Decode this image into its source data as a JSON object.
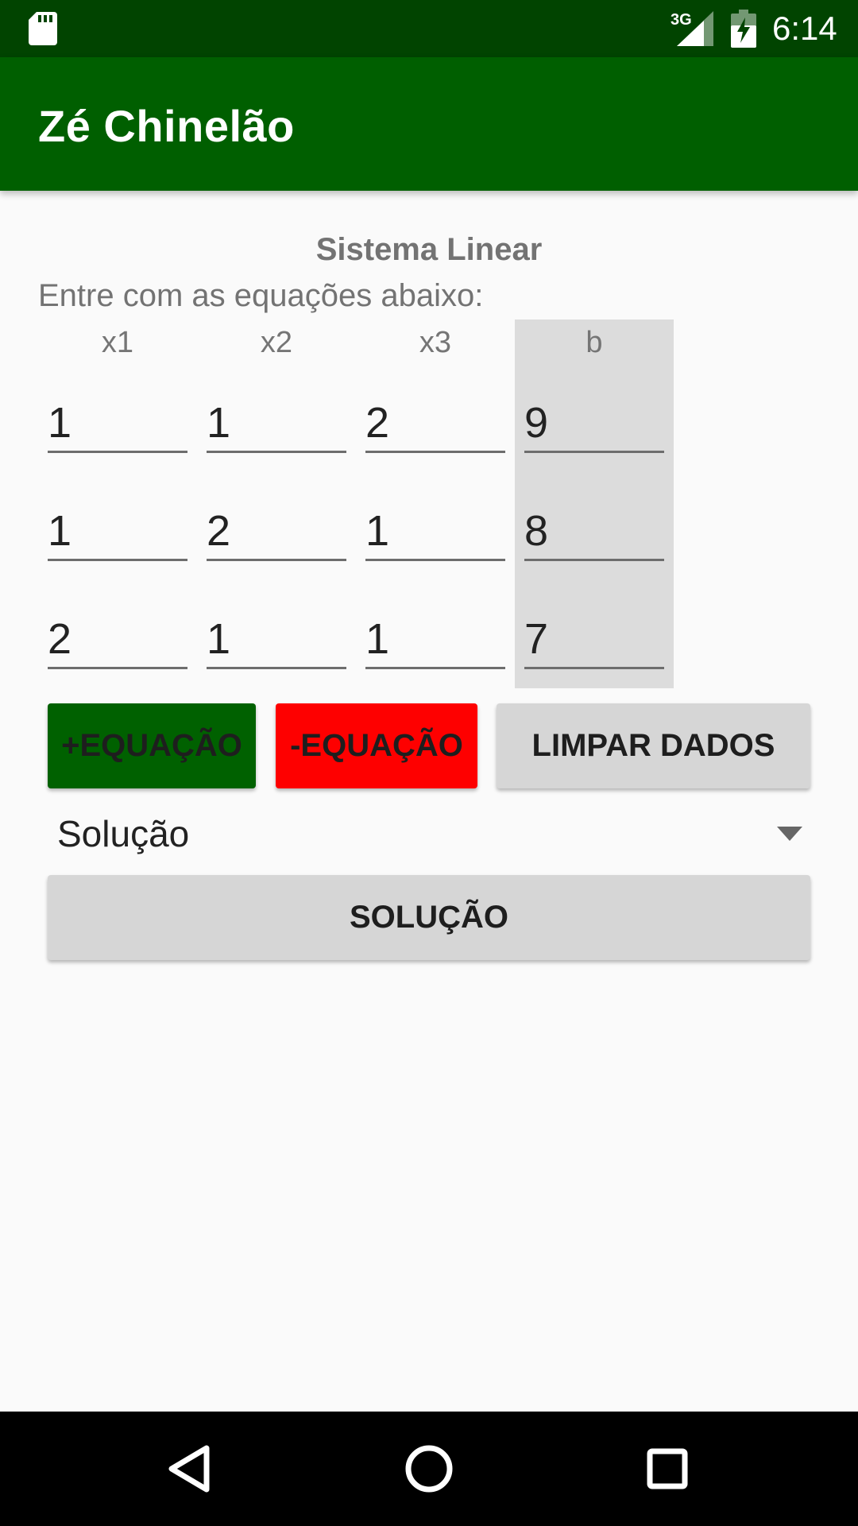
{
  "status_bar": {
    "network": "3G",
    "time": "6:14"
  },
  "app_bar": {
    "title": "Zé Chinelão"
  },
  "main": {
    "section_title": "Sistema Linear",
    "instructions": "Entre com as equações abaixo:",
    "column_headers": [
      "x1",
      "x2",
      "x3",
      "b"
    ],
    "matrix": [
      [
        "1",
        "1",
        "2",
        "9"
      ],
      [
        "1",
        "2",
        "1",
        "8"
      ],
      [
        "2",
        "1",
        "1",
        "7"
      ]
    ],
    "buttons": {
      "add_equation": "+EQUAÇÃO",
      "remove_equation": "-EQUAÇÃO",
      "clear_data": "LIMPAR DADOS",
      "solve": "SOLUÇÃO"
    },
    "method_select": {
      "selected": "Solução"
    }
  },
  "colors": {
    "status_bar": "#014400",
    "app_bar": "#005f00",
    "add_button": "#006100",
    "remove_button": "#fe0000",
    "neutral_button": "#d6d6d6",
    "b_column": "#dcdcdc"
  }
}
